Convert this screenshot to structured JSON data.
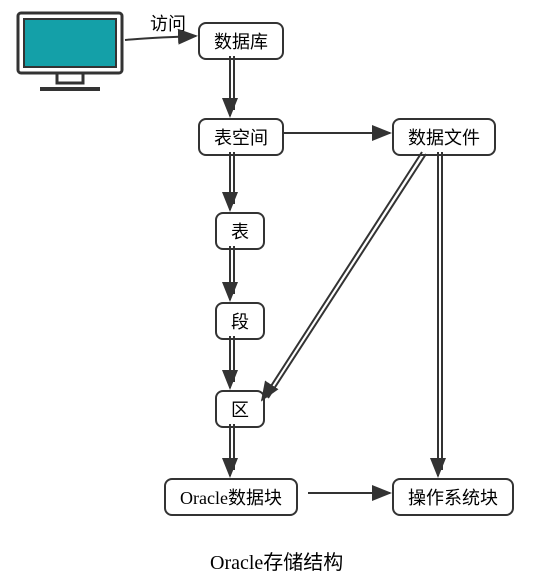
{
  "nodes": {
    "database": "数据库",
    "tablespace": "表空间",
    "datafile": "数据文件",
    "table": "表",
    "segment": "段",
    "extent": "区",
    "oracle_block": "Oracle数据块",
    "os_block": "操作系统块"
  },
  "edge_label": "访问",
  "caption": "Oracle存储结构",
  "edges": [
    {
      "from": "monitor",
      "to": "database",
      "label": "访问"
    },
    {
      "from": "database",
      "to": "tablespace"
    },
    {
      "from": "tablespace",
      "to": "datafile"
    },
    {
      "from": "tablespace",
      "to": "table"
    },
    {
      "from": "table",
      "to": "segment"
    },
    {
      "from": "segment",
      "to": "extent"
    },
    {
      "from": "extent",
      "to": "oracle_block"
    },
    {
      "from": "datafile",
      "to": "extent"
    },
    {
      "from": "datafile",
      "to": "os_block"
    },
    {
      "from": "oracle_block",
      "to": "os_block"
    }
  ]
}
